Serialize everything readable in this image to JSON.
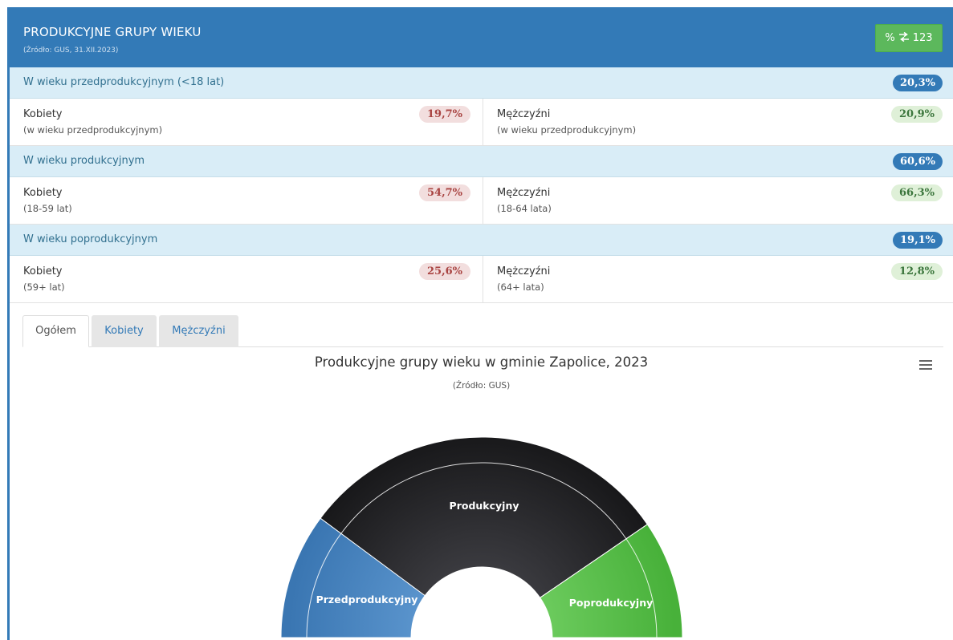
{
  "panel": {
    "title": "PRODUKCYJNE GRUPY WIEKU",
    "source": "(Źródło: GUS, 31.XII.2023)",
    "toggle": {
      "pct": "%",
      "icon": "exchange-icon",
      "num": "123"
    }
  },
  "groups": [
    {
      "label": "W wieku przedprodukcyjnym (<18 lat)",
      "value": "20,3%",
      "women": {
        "title": "Kobiety",
        "sub": "(w wieku przedprodukcyjnym)",
        "value": "19,7%"
      },
      "men": {
        "title": "Mężczyźni",
        "sub": "(w wieku przedprodukcyjnym)",
        "value": "20,9%"
      }
    },
    {
      "label": "W wieku produkcyjnym",
      "value": "60,6%",
      "women": {
        "title": "Kobiety",
        "sub": "(18-59 lat)",
        "value": "54,7%"
      },
      "men": {
        "title": "Mężczyźni",
        "sub": "(18-64 lata)",
        "value": "66,3%"
      }
    },
    {
      "label": "W wieku poprodukcyjnym",
      "value": "19,1%",
      "women": {
        "title": "Kobiety",
        "sub": "(59+ lat)",
        "value": "25,6%"
      },
      "men": {
        "title": "Mężczyźni",
        "sub": "(64+ lata)",
        "value": "12,8%"
      }
    }
  ],
  "tabs": [
    "Ogółem",
    "Kobiety",
    "Mężczyźni"
  ],
  "active_tab": "Ogółem",
  "colors": {
    "header": "#337ab7",
    "toggle": "#5cb85c",
    "pre": "#4a85c0",
    "prod": "#2b2b2e",
    "post": "#5cc24e"
  },
  "chart_data": {
    "type": "pie",
    "subtype": "semi-circle donut",
    "title": "Produkcyjne grupy wieku w gminie Zapolice, 2023",
    "subtitle": "(Źródło: GUS)",
    "series": [
      {
        "name": "Produkcyjne grupy wieku",
        "categories": [
          "Przedprodukcyjny",
          "Produkcyjny",
          "Poprodukcyjny"
        ],
        "values": [
          20.3,
          60.6,
          19.1
        ],
        "unit": "%"
      }
    ]
  }
}
